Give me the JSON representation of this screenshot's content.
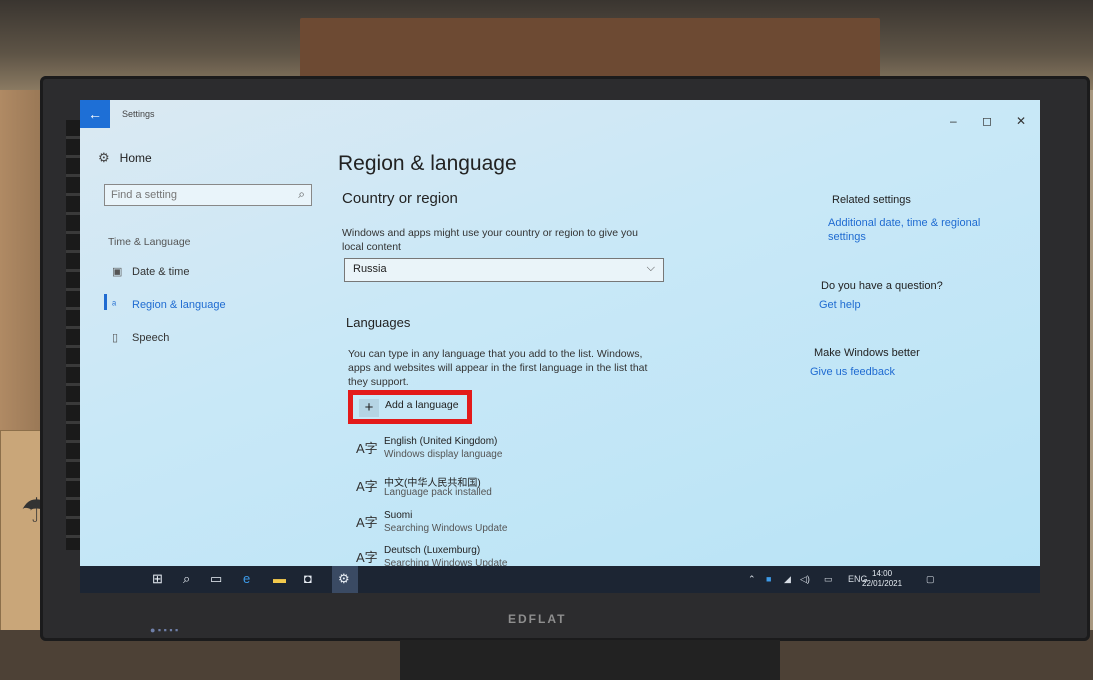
{
  "app": {
    "title": "Settings",
    "back_glyph": "←"
  },
  "window_controls": {
    "minimize": "–",
    "maximize": "◻",
    "close": "✕"
  },
  "sidebar": {
    "home_label": "Home",
    "search_placeholder": "Find a setting",
    "section_label": "Time & Language",
    "items": [
      {
        "label": "Date & time",
        "icon": "calendar-clock-icon",
        "glyph": "🗓"
      },
      {
        "label": "Region & language",
        "icon": "globe-language-icon",
        "glyph": "A",
        "active": true
      },
      {
        "label": "Speech",
        "icon": "microphone-icon",
        "glyph": "🎙"
      }
    ]
  },
  "main": {
    "title": "Region & language",
    "country_heading": "Country or region",
    "country_desc": "Windows and apps might use your country or region to give you local content",
    "country_value": "Russia",
    "languages_heading": "Languages",
    "languages_desc": "You can type in any language that you add to the list. Windows, apps and websites will appear in the first language in the list that they support.",
    "add_language_label": "Add a language",
    "languages": [
      {
        "name": "English (United Kingdom)",
        "status": "Windows display language"
      },
      {
        "name": "中文(中华人民共和国)",
        "status": "Language pack installed"
      },
      {
        "name": "Suomi",
        "status": "Searching Windows Update"
      },
      {
        "name": "Deutsch (Luxemburg)",
        "status": "Searching Windows Update"
      }
    ]
  },
  "related": {
    "heading": "Related settings",
    "link": "Additional date, time & regional settings",
    "question_heading": "Do you have a question?",
    "help_link": "Get help",
    "feedback_heading": "Make Windows better",
    "feedback_link": "Give us feedback"
  },
  "taskbar": {
    "lang": "ENG",
    "time": "14:00",
    "date": "22/01/2021"
  },
  "monitor": {
    "brand": "EDFLAT"
  },
  "colors": {
    "accent": "#1f6bd1",
    "highlight": "#e31a1a",
    "taskbar": "#1c2533"
  }
}
